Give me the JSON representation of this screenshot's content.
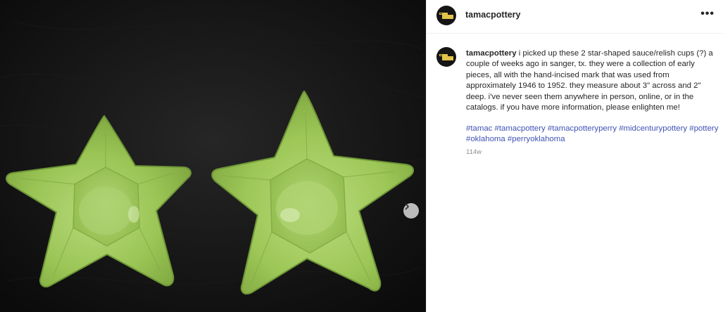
{
  "post": {
    "username": "tamacpottery",
    "more_label": "•••",
    "caption": {
      "username": "tamacpottery",
      "text": "i picked up these 2 star-shaped sauce/relish cups (?) a couple of weeks ago in sanger, tx. they were a collection of early pieces, all with the hand-incised mark that was used from approximately 1946 to 1952. they measure about 3\" across and 2\" deep. i've never seen them anywhere in person, online, or in the catalogs. if you have more information, please enlighten me!"
    },
    "hashtags": [
      "#tamac",
      "#tamacpottery",
      "#tamacpotteryperry",
      "#midcenturypottery",
      "#pottery",
      "#oklahoma",
      "#perryoklahoma"
    ],
    "age": "114w"
  },
  "icons": {
    "avatar": "oklahoma-state-logo-icon",
    "more": "more-options-icon",
    "next": "chevron-right-icon"
  },
  "colors": {
    "hashtag": "#3f52b5",
    "avatar_bg": "#151515",
    "logo": "#e2c34a",
    "dish": "#9cc657",
    "cloth": "#121212"
  }
}
